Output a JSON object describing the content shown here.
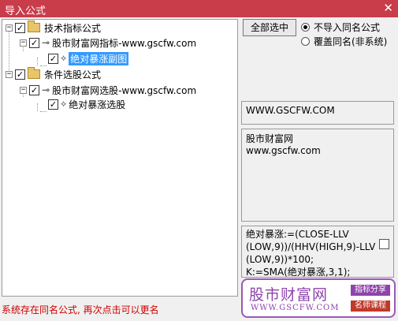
{
  "window": {
    "title": "导入公式",
    "close": "✕"
  },
  "tree": {
    "groups": [
      {
        "label": "技术指标公式",
        "child": {
          "label": "股市财富网指标-www.gscfw.com",
          "leaf": "绝对暴涨副图"
        }
      },
      {
        "label": "条件选股公式",
        "child": {
          "label": "股市财富网选股-www.gscfw.com",
          "leaf": "绝对暴涨选股"
        }
      }
    ]
  },
  "select_all_button": "全部选中",
  "options": {
    "no_import": "不导入同名公式",
    "overwrite": "覆盖同名(非系统)"
  },
  "url_box": "WWW.GSCFW.COM",
  "info_box": {
    "line1": "股市财富网",
    "line2": "www.gscfw.com"
  },
  "code_box": {
    "line1": "绝对暴涨:=(CLOSE-LLV",
    "line2": "(LOW,9))/(HHV(HIGH,9)-LLV",
    "line3": "(LOW,9))*100;",
    "line4": "K:=SMA(绝对暴涨,3,1);"
  },
  "status": "系统存在同名公式, 再次点击可以更名",
  "logo": {
    "name": "股市财富网",
    "url": "WWW.GSCFW.COM",
    "tag1": "指标分享",
    "tag2": "名师课程"
  }
}
